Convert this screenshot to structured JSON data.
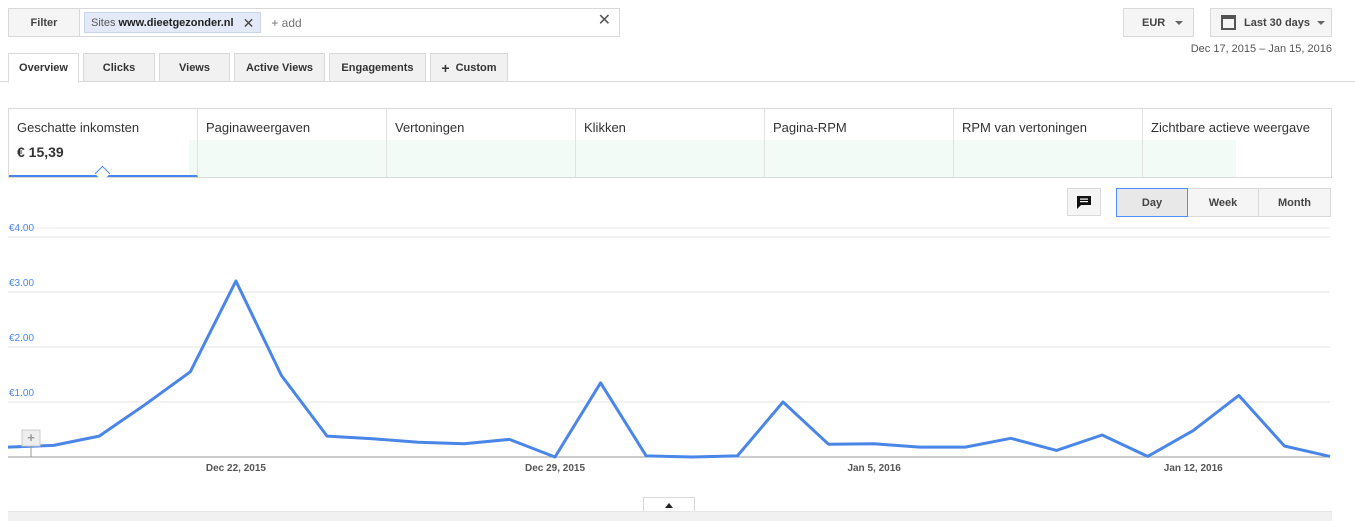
{
  "toolbar": {
    "filter_label": "Filter",
    "chip_key": "Sites",
    "chip_value": "www.dieetgezonder.nl",
    "add_placeholder": "+ add",
    "currency": "EUR",
    "date_range_label": "Last 30 days",
    "date_range_sub": "Dec 17, 2015 – Jan 15, 2016"
  },
  "tabs": [
    {
      "label": "Overview",
      "active": true
    },
    {
      "label": "Clicks"
    },
    {
      "label": "Views"
    },
    {
      "label": "Active Views"
    },
    {
      "label": "Engagements"
    },
    {
      "label": "Custom",
      "icon": "plus-icon"
    }
  ],
  "metrics": [
    {
      "label": "Geschatte inkomsten",
      "value": "€ 15,39",
      "active": true
    },
    {
      "label": "Paginaweergaven",
      "value": ""
    },
    {
      "label": "Vertoningen",
      "value": ""
    },
    {
      "label": "Klikken",
      "value": ""
    },
    {
      "label": "Pagina-RPM",
      "value": ""
    },
    {
      "label": "RPM van vertoningen",
      "value": ""
    },
    {
      "label": "Zichtbare actieve weergave",
      "value": ""
    }
  ],
  "granularity": [
    {
      "label": "Day",
      "active": true
    },
    {
      "label": "Week"
    },
    {
      "label": "Month"
    }
  ],
  "icons": {
    "comment": "comment-icon",
    "calendar": "calendar-icon",
    "clear": "close-icon",
    "expand": "chevron-up-icon"
  },
  "colors": {
    "series": "#4a86e8",
    "axis_label": "#4a86e8"
  },
  "chart_data": {
    "type": "line",
    "ylim": [
      0,
      4
    ],
    "y_ticks": [
      "€1.00",
      "€2.00",
      "€3.00",
      "€4.00"
    ],
    "x_tick_labels": [
      "Dec 22, 2015",
      "Dec 29, 2015",
      "Jan 5, 2016",
      "Jan 12, 2016"
    ],
    "x_tick_indices": [
      5,
      12,
      19,
      26
    ],
    "grid": true,
    "series": [
      {
        "values": [
          0.18,
          0.21,
          0.38,
          0.95,
          1.55,
          3.2,
          1.48,
          0.38,
          0.33,
          0.27,
          0.24,
          0.32,
          0.0,
          1.35,
          0.02,
          0.0,
          0.02,
          1.0,
          0.23,
          0.24,
          0.18,
          0.18,
          0.34,
          0.12,
          0.4,
          0.01,
          0.48,
          1.12,
          0.2,
          0.01
        ]
      }
    ]
  }
}
